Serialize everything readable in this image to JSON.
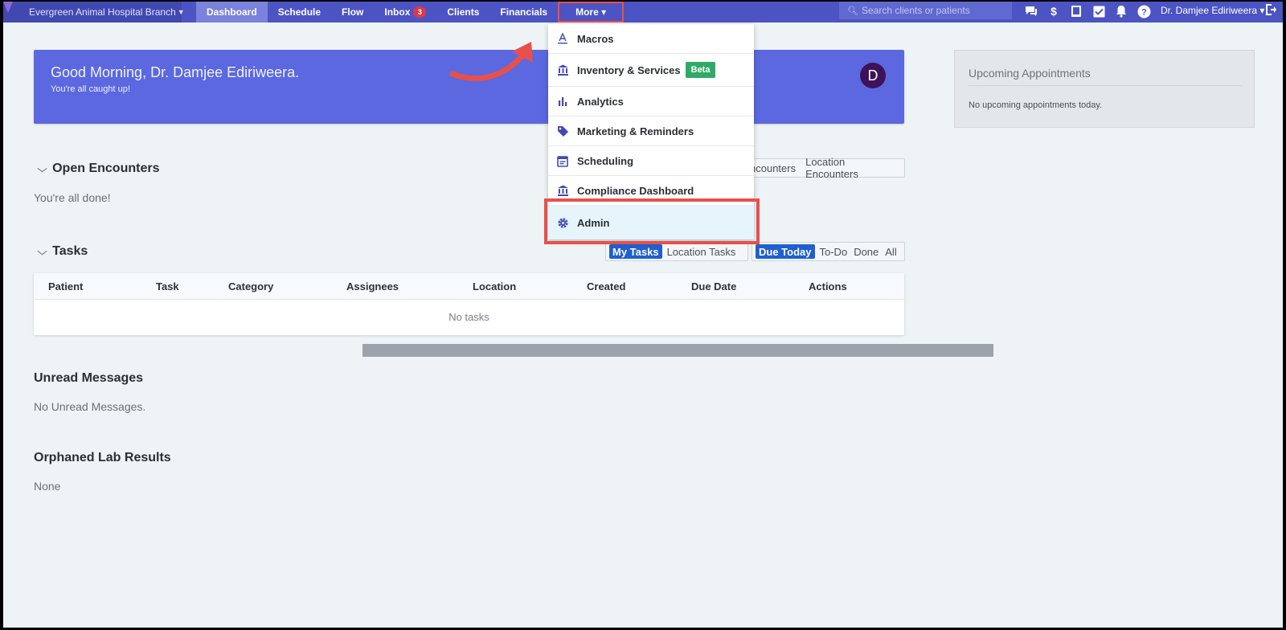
{
  "nav": {
    "branch": "Evergreen Animal Hospital Branch",
    "links": [
      {
        "label": "Dashboard"
      },
      {
        "label": "Schedule"
      },
      {
        "label": "Flow"
      },
      {
        "label": "Inbox",
        "badge": "3"
      },
      {
        "label": "Clients"
      },
      {
        "label": "Financials"
      },
      {
        "label": "More ▾"
      }
    ],
    "search_placeholder": "Search clients or patients",
    "user": "Dr. Damjee Ediriweera ▾"
  },
  "greeting": {
    "title": "Good Morning, Dr. Damjee Ediriweera.",
    "subtitle": "You're all caught up!",
    "avatar_letter": "D"
  },
  "upcoming": {
    "title": "Upcoming Appointments",
    "empty": "No upcoming appointments today."
  },
  "encounters": {
    "title": "Open Encounters",
    "empty": "You're all done!",
    "toggle": [
      "ncounters",
      "Location Encounters"
    ]
  },
  "tasks": {
    "title": "Tasks",
    "toggle_scope": [
      "My Tasks",
      "Location Tasks"
    ],
    "toggle_status": [
      "Due Today",
      "To-Do",
      "Done",
      "All"
    ],
    "columns": [
      "Patient",
      "Task",
      "Category",
      "Assignees",
      "Location",
      "Created",
      "Due Date",
      "Actions"
    ],
    "empty": "No tasks"
  },
  "messages": {
    "title": "Unread Messages",
    "empty": "No Unread Messages."
  },
  "lab": {
    "title": "Orphaned Lab Results",
    "empty": "None"
  },
  "menu": {
    "items": [
      {
        "label": "Macros",
        "icon": "text-format-icon"
      },
      {
        "label": "Inventory & Services",
        "icon": "bank-icon",
        "badge": "Beta"
      },
      {
        "label": "Analytics",
        "icon": "bar-chart-icon"
      },
      {
        "label": "Marketing & Reminders",
        "icon": "tag-icon"
      },
      {
        "label": "Scheduling",
        "icon": "calendar-icon"
      },
      {
        "label": "Compliance Dashboard",
        "icon": "bank-icon"
      },
      {
        "label": "Admin",
        "icon": "gear-icon"
      }
    ]
  },
  "colors": {
    "nav_bg": "#4c54c4",
    "banner_bg": "#5b68e0",
    "highlight": "#e8504a",
    "beta": "#2eaa66",
    "toggle_on": "#1f5fd0"
  }
}
